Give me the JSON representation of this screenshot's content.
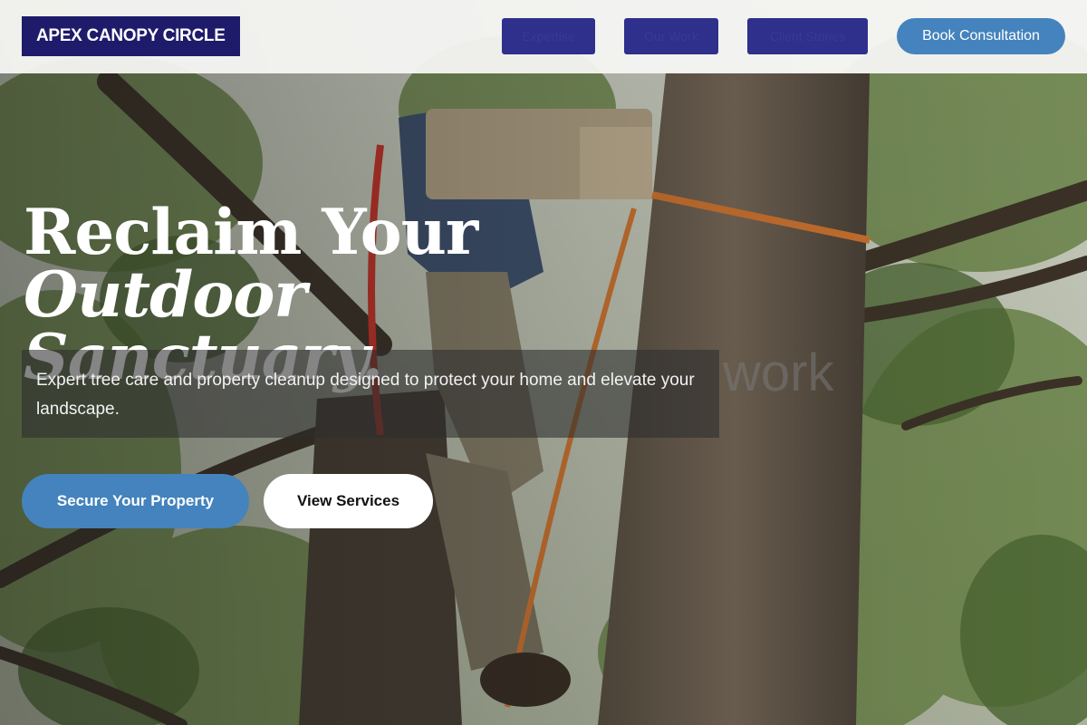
{
  "header": {
    "brand": "APEX CANOPY CIRCLE",
    "nav": [
      {
        "label": "Expertise"
      },
      {
        "label": "Our Work"
      },
      {
        "label": "Client Stories"
      }
    ],
    "cta_label": "Book Consultation"
  },
  "hero": {
    "title_line1_plain": "Reclaim Your ",
    "title_line1_italic": "Outdoor",
    "title_line2_italic": "Sanctuary.",
    "ghost_text": "work",
    "subtitle": "Expert tree care and property cleanup designed to protect your home and elevate your landscape.",
    "primary_button": "Secure Your Property",
    "secondary_button": "View Services"
  },
  "colors": {
    "brand_bg": "#1e1b6b",
    "nav_bg": "#2f2f8c",
    "accent": "#4483bd",
    "header_bg": "#f6f6f3"
  }
}
